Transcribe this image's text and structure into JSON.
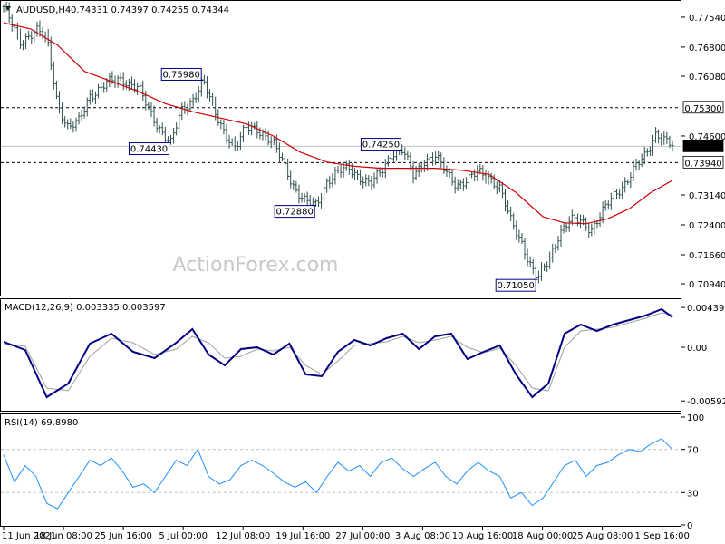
{
  "header": {
    "symbol": "AUDUSD,H4",
    "ohlc": "0.74331 0.74397 0.74255 0.74344"
  },
  "watermark": "ActionForex.com",
  "colors": {
    "candle": "#2f4f4f",
    "ma": "#cc0000",
    "macd_main": "#000080",
    "macd_signal": "#a0a0a0",
    "rsi": "#1e90ff",
    "level_line": "#000000",
    "grid": "#c0c0c0",
    "label_border": "#000080"
  },
  "chart_data": [
    {
      "type": "candlestick",
      "title": "AUDUSD,H4",
      "ylim": [
        0.7065,
        0.7792
      ],
      "y_ticks": [
        "0.77540",
        "0.76800",
        "0.76080",
        "0.74600",
        "0.73140",
        "0.72400",
        "0.71660",
        "0.70940"
      ],
      "x_tick_labels": [
        "11 Jun 2021",
        "18 Jun 08:00",
        "25 Jun 16:00",
        "5 Jul 00:00",
        "12 Jul 08:00",
        "19 Jul 16:00",
        "27 Jul 00:00",
        "3 Aug 08:00",
        "10 Aug 16:00",
        "18 Aug 00:00",
        "25 Aug 08:00",
        "1 Sep 16:00"
      ],
      "horizontal_levels": [
        {
          "label": "0.75300",
          "value": 0.753,
          "style": "dashed"
        },
        {
          "label": "0.73940",
          "value": 0.7394,
          "style": "dashed"
        }
      ],
      "current_price": {
        "label": "0.74344",
        "value": 0.74344
      },
      "annotations": [
        {
          "label": "0.75980",
          "value": 0.7598
        },
        {
          "label": "0.74430",
          "value": 0.7443
        },
        {
          "label": "0.72880",
          "value": 0.7288
        },
        {
          "label": "0.74250",
          "value": 0.7425
        },
        {
          "label": "0.71050",
          "value": 0.7105
        }
      ],
      "price_path": [
        [
          0,
          0.778
        ],
        [
          3,
          0.769
        ],
        [
          6,
          0.7725
        ],
        [
          8,
          0.77
        ],
        [
          10,
          0.754
        ],
        [
          12,
          0.748
        ],
        [
          14,
          0.7495
        ],
        [
          16,
          0.756
        ],
        [
          19,
          0.759
        ],
        [
          22,
          0.76
        ],
        [
          25,
          0.758
        ],
        [
          27,
          0.752
        ],
        [
          29,
          0.7478
        ],
        [
          31,
          0.7443
        ],
        [
          33,
          0.752
        ],
        [
          35,
          0.755
        ],
        [
          37,
          0.7598
        ],
        [
          39,
          0.752
        ],
        [
          41,
          0.747
        ],
        [
          43,
          0.743
        ],
        [
          45,
          0.748
        ],
        [
          47,
          0.748
        ],
        [
          50,
          0.744
        ],
        [
          52,
          0.739
        ],
        [
          54,
          0.733
        ],
        [
          56,
          0.7295
        ],
        [
          58,
          0.7288
        ],
        [
          60,
          0.735
        ],
        [
          62,
          0.737
        ],
        [
          64,
          0.738
        ],
        [
          66,
          0.736
        ],
        [
          68,
          0.734
        ],
        [
          70,
          0.737
        ],
        [
          72,
          0.742
        ],
        [
          74,
          0.7425
        ],
        [
          76,
          0.736
        ],
        [
          78,
          0.74
        ],
        [
          80,
          0.741
        ],
        [
          82,
          0.737
        ],
        [
          84,
          0.734
        ],
        [
          86,
          0.735
        ],
        [
          88,
          0.737
        ],
        [
          90,
          0.736
        ],
        [
          92,
          0.733
        ],
        [
          94,
          0.725
        ],
        [
          96,
          0.72
        ],
        [
          98,
          0.713
        ],
        [
          99,
          0.7105
        ],
        [
          101,
          0.715
        ],
        [
          103,
          0.722
        ],
        [
          105,
          0.725
        ],
        [
          107,
          0.725
        ],
        [
          109,
          0.723
        ],
        [
          111,
          0.727
        ],
        [
          113,
          0.731
        ],
        [
          115,
          0.734
        ],
        [
          117,
          0.738
        ],
        [
          119,
          0.741
        ],
        [
          121,
          0.747
        ],
        [
          123,
          0.7445
        ],
        [
          124,
          0.7434
        ]
      ],
      "ma_path": [
        [
          0,
          0.774
        ],
        [
          5,
          0.7725
        ],
        [
          10,
          0.7685
        ],
        [
          15,
          0.762
        ],
        [
          20,
          0.7595
        ],
        [
          25,
          0.757
        ],
        [
          30,
          0.754
        ],
        [
          35,
          0.752
        ],
        [
          40,
          0.7505
        ],
        [
          45,
          0.749
        ],
        [
          50,
          0.746
        ],
        [
          55,
          0.742
        ],
        [
          60,
          0.7395
        ],
        [
          65,
          0.7385
        ],
        [
          70,
          0.738
        ],
        [
          75,
          0.738
        ],
        [
          80,
          0.738
        ],
        [
          85,
          0.7375
        ],
        [
          90,
          0.7365
        ],
        [
          95,
          0.732
        ],
        [
          100,
          0.726
        ],
        [
          104,
          0.7245
        ],
        [
          108,
          0.7243
        ],
        [
          112,
          0.7255
        ],
        [
          116,
          0.728
        ],
        [
          120,
          0.732
        ],
        [
          124,
          0.735
        ]
      ]
    },
    {
      "type": "line",
      "title": "MACD(12,26,9) 0.003335 0.003597",
      "ylim": [
        -0.0069,
        0.005
      ],
      "y_ticks": [
        "0.004391",
        "0.00",
        "-0.005922"
      ],
      "series": [
        {
          "name": "MACD",
          "points": [
            [
              0,
              0.0006
            ],
            [
              4,
              -0.0003
            ],
            [
              8,
              -0.0055
            ],
            [
              12,
              -0.004
            ],
            [
              16,
              0.0004
            ],
            [
              20,
              0.0015
            ],
            [
              24,
              -0.0005
            ],
            [
              28,
              -0.0012
            ],
            [
              32,
              0.0005
            ],
            [
              35,
              0.002
            ],
            [
              38,
              -0.0008
            ],
            [
              41,
              -0.002
            ],
            [
              44,
              -0.0002
            ],
            [
              47,
              0.0
            ],
            [
              50,
              -0.0008
            ],
            [
              53,
              0.0004
            ],
            [
              56,
              -0.003
            ],
            [
              59,
              -0.0032
            ],
            [
              62,
              -0.0005
            ],
            [
              65,
              0.0008
            ],
            [
              68,
              0.0002
            ],
            [
              71,
              0.001
            ],
            [
              74,
              0.0015
            ],
            [
              77,
              -0.0002
            ],
            [
              80,
              0.0012
            ],
            [
              83,
              0.0015
            ],
            [
              86,
              -0.0013
            ],
            [
              89,
              -0.0005
            ],
            [
              92,
              0.0002
            ],
            [
              95,
              -0.003
            ],
            [
              98,
              -0.0055
            ],
            [
              101,
              -0.004
            ],
            [
              104,
              0.0015
            ],
            [
              107,
              0.0025
            ],
            [
              110,
              0.0018
            ],
            [
              113,
              0.0025
            ],
            [
              116,
              0.003
            ],
            [
              119,
              0.0035
            ],
            [
              122,
              0.0042
            ],
            [
              124,
              0.0033
            ]
          ]
        },
        {
          "name": "Signal",
          "points": [
            [
              0,
              0.0004
            ],
            [
              4,
              0.0001
            ],
            [
              8,
              -0.0045
            ],
            [
              12,
              -0.0048
            ],
            [
              16,
              -0.001
            ],
            [
              20,
              0.001
            ],
            [
              24,
              0.0005
            ],
            [
              28,
              -0.0008
            ],
            [
              32,
              -0.0002
            ],
            [
              35,
              0.0012
            ],
            [
              38,
              0.0005
            ],
            [
              41,
              -0.0012
            ],
            [
              44,
              -0.001
            ],
            [
              47,
              -0.0002
            ],
            [
              50,
              -0.0004
            ],
            [
              53,
              0.0
            ],
            [
              56,
              -0.002
            ],
            [
              59,
              -0.003
            ],
            [
              62,
              -0.0015
            ],
            [
              65,
              0.0002
            ],
            [
              68,
              0.0004
            ],
            [
              71,
              0.0006
            ],
            [
              74,
              0.0012
            ],
            [
              77,
              0.0005
            ],
            [
              80,
              0.0008
            ],
            [
              83,
              0.0012
            ],
            [
              86,
              0.0
            ],
            [
              89,
              -0.0006
            ],
            [
              92,
              -0.0001
            ],
            [
              95,
              -0.002
            ],
            [
              98,
              -0.0045
            ],
            [
              101,
              -0.0048
            ],
            [
              104,
              0.0
            ],
            [
              107,
              0.0018
            ],
            [
              110,
              0.002
            ],
            [
              113,
              0.0022
            ],
            [
              116,
              0.0027
            ],
            [
              119,
              0.0032
            ],
            [
              122,
              0.0038
            ],
            [
              124,
              0.0036
            ]
          ]
        }
      ]
    },
    {
      "type": "line",
      "title": "RSI(14) 69.8980",
      "ylim": [
        0,
        100
      ],
      "y_ticks": [
        "100",
        "70",
        "30",
        "0"
      ],
      "levels": [
        70,
        30
      ],
      "series": [
        {
          "name": "RSI",
          "points": [
            [
              0,
              65
            ],
            [
              2,
              40
            ],
            [
              4,
              55
            ],
            [
              6,
              45
            ],
            [
              8,
              20
            ],
            [
              10,
              15
            ],
            [
              12,
              30
            ],
            [
              14,
              45
            ],
            [
              16,
              60
            ],
            [
              18,
              55
            ],
            [
              20,
              62
            ],
            [
              22,
              50
            ],
            [
              24,
              35
            ],
            [
              26,
              38
            ],
            [
              28,
              30
            ],
            [
              30,
              45
            ],
            [
              32,
              60
            ],
            [
              34,
              55
            ],
            [
              36,
              70
            ],
            [
              38,
              45
            ],
            [
              40,
              38
            ],
            [
              42,
              42
            ],
            [
              44,
              55
            ],
            [
              46,
              60
            ],
            [
              48,
              55
            ],
            [
              50,
              48
            ],
            [
              52,
              40
            ],
            [
              54,
              35
            ],
            [
              56,
              40
            ],
            [
              58,
              30
            ],
            [
              60,
              45
            ],
            [
              62,
              58
            ],
            [
              64,
              50
            ],
            [
              66,
              55
            ],
            [
              68,
              45
            ],
            [
              70,
              58
            ],
            [
              72,
              62
            ],
            [
              74,
              52
            ],
            [
              76,
              45
            ],
            [
              78,
              52
            ],
            [
              80,
              58
            ],
            [
              82,
              45
            ],
            [
              84,
              38
            ],
            [
              86,
              50
            ],
            [
              88,
              58
            ],
            [
              90,
              50
            ],
            [
              92,
              45
            ],
            [
              94,
              25
            ],
            [
              96,
              30
            ],
            [
              98,
              18
            ],
            [
              100,
              25
            ],
            [
              102,
              40
            ],
            [
              104,
              55
            ],
            [
              106,
              60
            ],
            [
              108,
              45
            ],
            [
              110,
              55
            ],
            [
              112,
              58
            ],
            [
              114,
              65
            ],
            [
              116,
              70
            ],
            [
              118,
              68
            ],
            [
              120,
              75
            ],
            [
              122,
              80
            ],
            [
              124,
              70
            ]
          ]
        }
      ]
    }
  ]
}
